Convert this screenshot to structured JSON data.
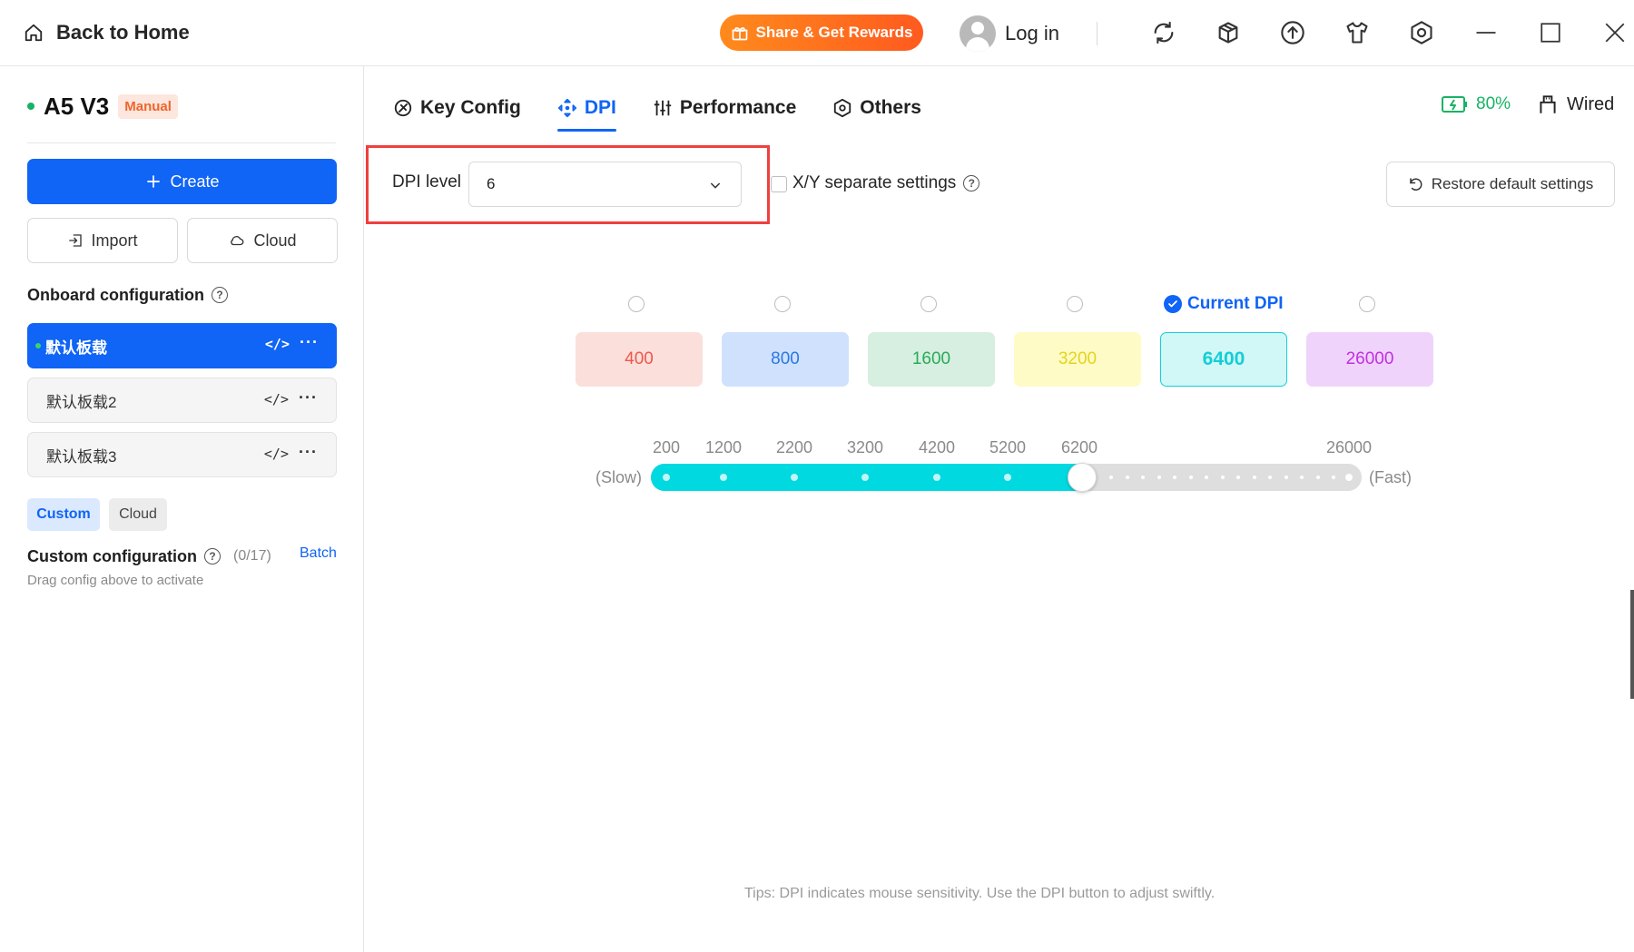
{
  "titlebar": {
    "back_label": "Back to Home",
    "share_label": "Share & Get Rewards",
    "login_label": "Log in",
    "icons": [
      "sync-icon",
      "package-icon",
      "upload-icon",
      "tshirt-icon",
      "settings-hex-icon",
      "minimize-icon",
      "maximize-icon",
      "close-icon"
    ]
  },
  "sidebar": {
    "device_name": "A5 V3",
    "mode_badge": "Manual",
    "create_label": "Create",
    "import_label": "Import",
    "cloud_label": "Cloud",
    "onboard_title": "Onboard configuration",
    "configs": [
      {
        "name": "默认板载",
        "active": true
      },
      {
        "name": "默认板载2",
        "active": false
      },
      {
        "name": "默认板载3",
        "active": false
      }
    ],
    "config_code_glyph": "</>",
    "config_more_glyph": "···",
    "filter_custom": "Custom",
    "filter_cloud": "Cloud",
    "custom_title": "Custom configuration",
    "custom_count": "(0/17)",
    "batch_label": "Batch",
    "drag_hint": "Drag config above to activate"
  },
  "tabs": [
    {
      "label": "Key Config",
      "active": false
    },
    {
      "label": "DPI",
      "active": true
    },
    {
      "label": "Performance",
      "active": false
    },
    {
      "label": "Others",
      "active": false
    }
  ],
  "status": {
    "battery": "80%",
    "connection": "Wired"
  },
  "dpi": {
    "level_label": "DPI level",
    "level_value": "6",
    "xy_label": "X/Y separate settings",
    "xy_checked": false,
    "restore_label": "Restore default settings",
    "current_label": "Current DPI",
    "current_index": 4,
    "values": [
      {
        "value": "400",
        "bg": "#fbdfdb",
        "fg": "#f0564b",
        "border": "#fbdfdb"
      },
      {
        "value": "800",
        "bg": "#cfe1fc",
        "fg": "#2a78e4",
        "border": "#cfe1fc"
      },
      {
        "value": "1600",
        "bg": "#d6efe0",
        "fg": "#2aaa5a",
        "border": "#d6efe0"
      },
      {
        "value": "3200",
        "bg": "#fefbc7",
        "fg": "#e6d41a",
        "border": "#fefbc7"
      },
      {
        "value": "6400",
        "bg": "#d2f7f7",
        "fg": "#12cfd6",
        "border": "#12cfd6"
      },
      {
        "value": "26000",
        "bg": "#f0d3fb",
        "fg": "#c030e0",
        "border": "#f0d3fb"
      }
    ]
  },
  "slider": {
    "slow_label": "(Slow)",
    "fast_label": "(Fast)",
    "ticks": [
      "200",
      "1200",
      "2200",
      "3200",
      "4200",
      "5200",
      "6200",
      "26000"
    ],
    "min": 200,
    "max": 26000,
    "current": 6400,
    "fill_color": "#00d9e0"
  },
  "tips": "Tips: DPI indicates mouse sensitivity. Use the DPI button to adjust swiftly.",
  "colors": {
    "accent": "#1064f6",
    "online": "#16b364",
    "highlight_box": "#ef3f3f"
  }
}
